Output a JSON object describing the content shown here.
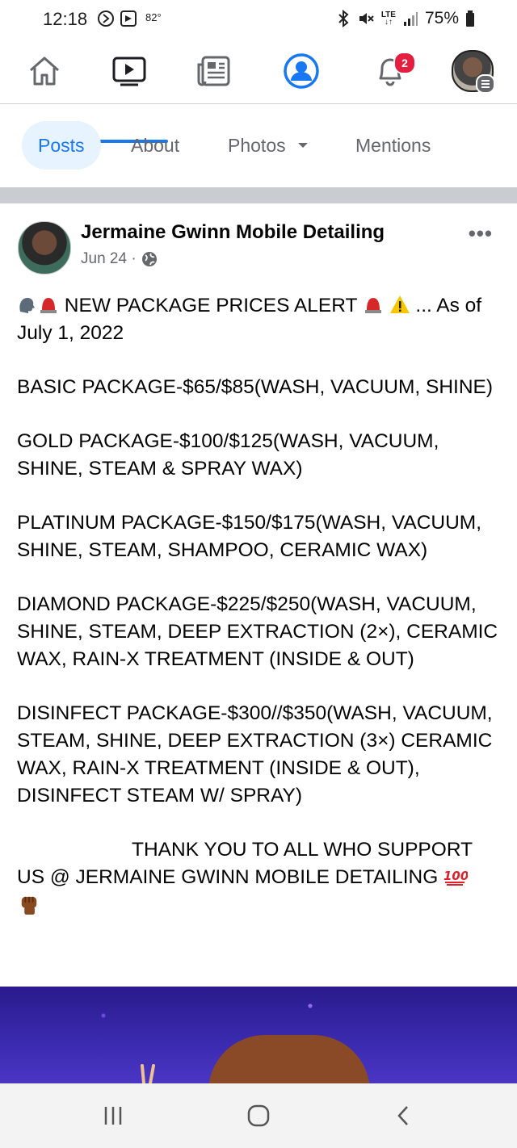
{
  "status_bar": {
    "time": "12:18",
    "temperature": "82°",
    "network": "LTE",
    "battery": "75%"
  },
  "top_nav": {
    "items": [
      "home-icon",
      "video-icon",
      "news-icon",
      "profile-icon",
      "notifications-icon",
      "menu-avatar"
    ],
    "notification_count": "2",
    "active_index": 1
  },
  "page_tabs": [
    {
      "label": "Posts"
    },
    {
      "label": "About"
    },
    {
      "label": "Photos"
    },
    {
      "label": "Mentions"
    }
  ],
  "post": {
    "author": "Jermaine Gwinn Mobile Detailing",
    "date": "Jun 24 ·",
    "lines": {
      "alert_text": " NEW PACKAGE PRICES ALERT ",
      "alert_tail": " ... As of July 1, 2022",
      "basic": "BASIC PACKAGE-$65/$85(WASH, VACUUM, SHINE)",
      "gold": "GOLD PACKAGE-$100/$125(WASH, VACUUM, SHINE, STEAM & SPRAY WAX)",
      "platinum": "PLATINUM  PACKAGE-$150/$175(WASH, VACUUM, SHINE, STEAM, SHAMPOO, CERAMIC WAX)",
      "diamond": "DIAMOND PACKAGE-$225/$250(WASH, VACUUM, SHINE, STEAM, DEEP EXTRACTION (2×), CERAMIC WAX, RAIN-X TREATMENT (INSIDE  & OUT)",
      "disinfect": "DISINFECT  PACKAGE-$300//$350(WASH, VACUUM, STEAM, SHINE, DEEP EXTRACTION (3×) CERAMIC WAX, RAIN-X TREATMENT (INSIDE  & OUT), DISINFECT STEAM  W/ SPRAY)",
      "thanks": "THANK YOU TO ALL WHO SUPPORT US @ JERMAINE GWINN MOBILE DETAILING "
    }
  },
  "colors": {
    "accent": "#1877f2",
    "tab_active_bg": "#e7f3ff",
    "badge": "#e41e3f",
    "secondary_text": "#65676b"
  }
}
